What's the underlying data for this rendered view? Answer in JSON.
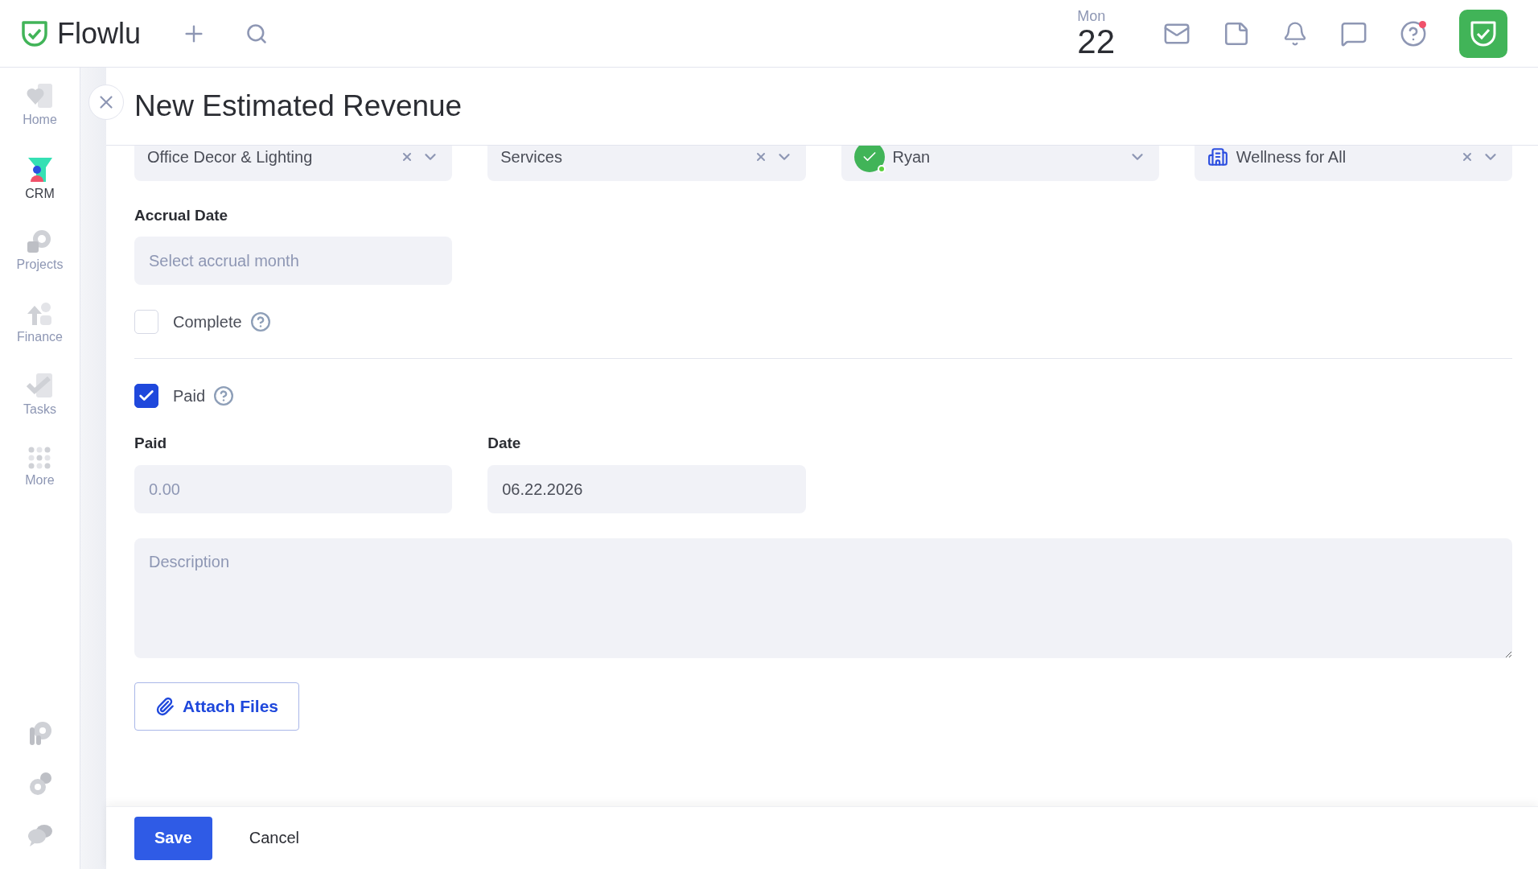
{
  "topbar": {
    "logo": "Flowlu",
    "date": {
      "weekday": "Mon",
      "day": "22"
    },
    "help_badge": true
  },
  "sidebar": {
    "items": [
      {
        "label": "Home",
        "selected": false
      },
      {
        "label": "CRM",
        "selected": true
      },
      {
        "label": "Projects",
        "selected": false
      },
      {
        "label": "Finance",
        "selected": false
      },
      {
        "label": "Tasks",
        "selected": false
      },
      {
        "label": "More",
        "selected": false
      }
    ]
  },
  "panel": {
    "title": "New Estimated Revenue",
    "top_fields": [
      {
        "kind": "select",
        "value": "Office Decor & Lighting",
        "clearable": true
      },
      {
        "kind": "select",
        "value": "Services",
        "clearable": true
      },
      {
        "kind": "user",
        "value": "Ryan",
        "clearable": false
      },
      {
        "kind": "company",
        "value": "Wellness for All",
        "clearable": true
      }
    ],
    "accrual_date": {
      "label": "Accrual Date",
      "placeholder": "Select accrual month"
    },
    "complete": {
      "label": "Complete",
      "checked": false
    },
    "paid_toggle": {
      "label": "Paid",
      "checked": true
    },
    "paid": {
      "label": "Paid",
      "placeholder": "0.00"
    },
    "date": {
      "label": "Date",
      "value": "06.22.2026"
    },
    "description": {
      "placeholder": "Description"
    },
    "attach": "Attach Files",
    "footer": {
      "save": "Save",
      "cancel": "Cancel"
    }
  }
}
